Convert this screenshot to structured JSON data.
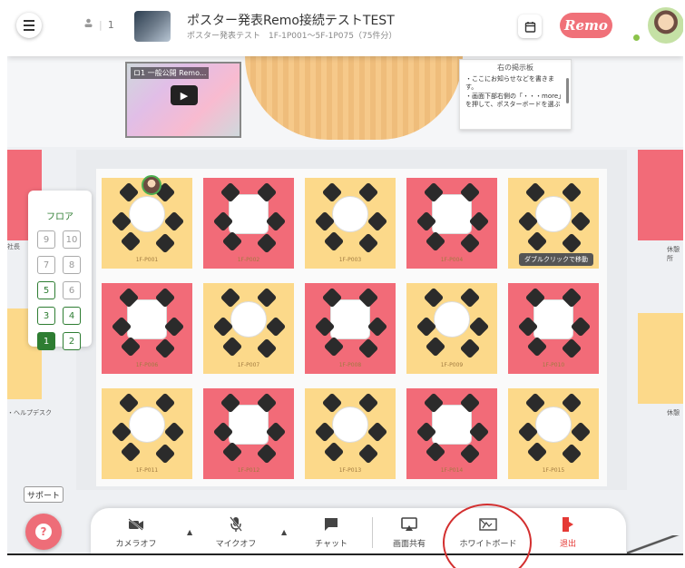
{
  "topbar": {
    "participants_count": "1",
    "event_title": "ポスター発表Remo接続テストTEST",
    "event_subtitle": "ポスター発表テスト　1F-1P001～5F-1P075（75件分）",
    "logo_text": "Remo"
  },
  "stage": {
    "video_title": "ロ1 一般公開 Remo...",
    "board_title": "右の掲示板",
    "board_lines": [
      "・ここにお知らせなどを書きます。",
      "・画面下部右側の「・・・more」を押して、ポスターボードを選ぶ"
    ]
  },
  "floor_panel": {
    "title": "フロア",
    "floors": [
      {
        "label": "9",
        "state": "inactive"
      },
      {
        "label": "10",
        "state": "inactive"
      },
      {
        "label": "7",
        "state": "inactive"
      },
      {
        "label": "8",
        "state": "inactive"
      },
      {
        "label": "5",
        "state": "active"
      },
      {
        "label": "6",
        "state": "inactive"
      },
      {
        "label": "3",
        "state": "active"
      },
      {
        "label": "4",
        "state": "active"
      },
      {
        "label": "1",
        "state": "current"
      },
      {
        "label": "2",
        "state": "active"
      }
    ]
  },
  "tables": [
    {
      "label": "1F-P001",
      "color": "#fcd98a"
    },
    {
      "label": "1F-P002",
      "color": "#f26b78"
    },
    {
      "label": "1F-P003",
      "color": "#fcd98a"
    },
    {
      "label": "1F-P004",
      "color": "#f26b78"
    },
    {
      "label": "1F-P005",
      "color": "#fcd98a"
    },
    {
      "label": "1F-P006",
      "color": "#f26b78"
    },
    {
      "label": "1F-P007",
      "color": "#fcd98a"
    },
    {
      "label": "1F-P008",
      "color": "#f26b78"
    },
    {
      "label": "1F-P009",
      "color": "#fcd98a"
    },
    {
      "label": "1F-P010",
      "color": "#f26b78"
    },
    {
      "label": "1F-P011",
      "color": "#fcd98a"
    },
    {
      "label": "1F-P012",
      "color": "#f26b78"
    },
    {
      "label": "1F-P013",
      "color": "#fcd98a"
    },
    {
      "label": "1F-P014",
      "color": "#f26b78"
    },
    {
      "label": "1F-P015",
      "color": "#fcd98a"
    }
  ],
  "double_click_hint": "ダブルクリックで移動",
  "side_labels": {
    "left_top": "社長",
    "left_bottom": "・ヘルプデスク",
    "right_top": "休憩所",
    "right_bottom": "休憩"
  },
  "support": {
    "label": "サポート"
  },
  "toolbar": {
    "camera_label": "カメラオフ",
    "mic_label": "マイクオフ",
    "chat_label": "チャット",
    "share_label": "画面共有",
    "whiteboard_label": "ホワイトボード",
    "leave_label": "退出"
  },
  "colors": {
    "accent_green": "#2e7d32",
    "remo_pink": "#f07179",
    "leave_red": "#e53935",
    "highlight_red": "#d32f2f"
  }
}
